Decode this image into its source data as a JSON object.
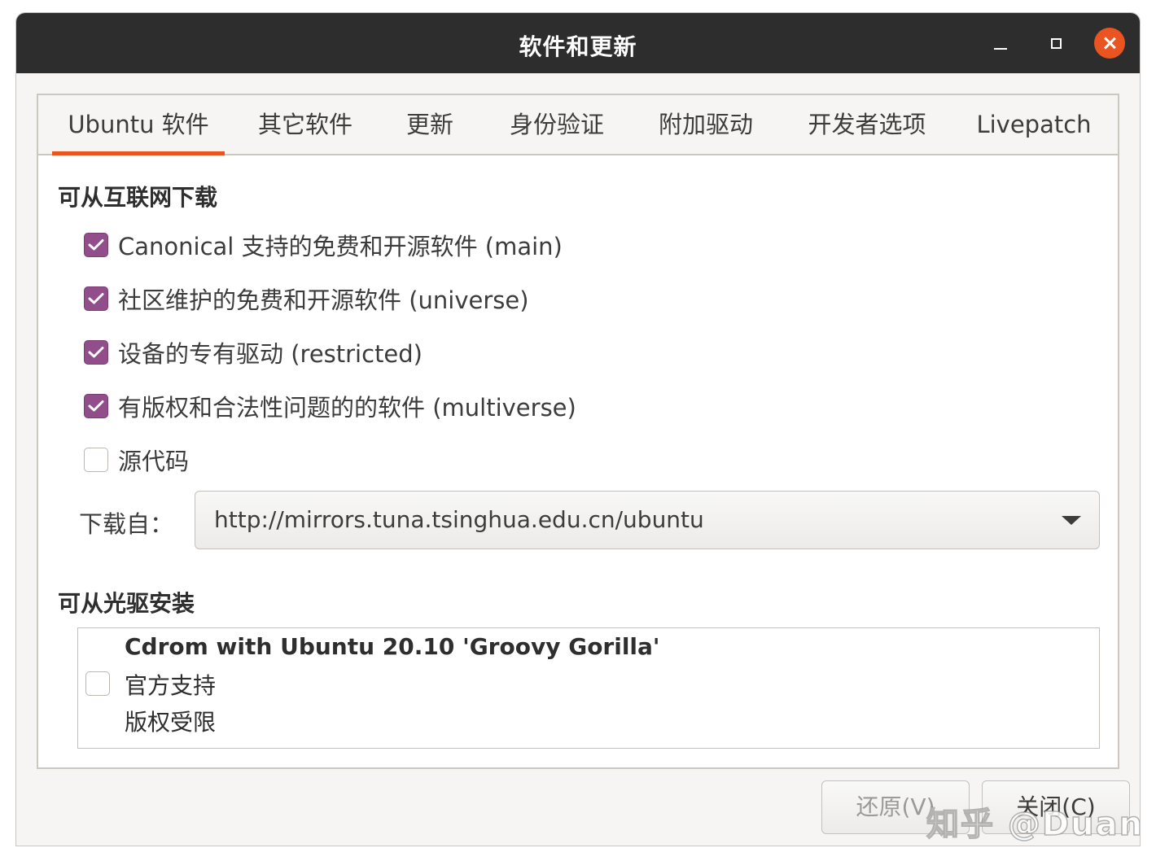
{
  "window": {
    "title": "软件和更新"
  },
  "tabs": [
    {
      "label": "Ubuntu 软件",
      "active": true
    },
    {
      "label": "其它软件",
      "active": false
    },
    {
      "label": "更新",
      "active": false
    },
    {
      "label": "身份验证",
      "active": false
    },
    {
      "label": "附加驱动",
      "active": false
    },
    {
      "label": "开发者选项",
      "active": false
    },
    {
      "label": "Livepatch",
      "active": false
    }
  ],
  "internet": {
    "title": "可从互联网下载",
    "options": [
      {
        "label": "Canonical 支持的免费和开源软件 (main)",
        "checked": true
      },
      {
        "label": "社区维护的免费和开源软件 (universe)",
        "checked": true
      },
      {
        "label": "设备的专有驱动 (restricted)",
        "checked": true
      },
      {
        "label": "有版权和合法性问题的的软件 (multiverse)",
        "checked": true
      },
      {
        "label": "源代码",
        "checked": false
      }
    ],
    "download_from_label": "下载自：",
    "download_from_value": "http://mirrors.tuna.tsinghua.edu.cn/ubuntu"
  },
  "cdrom": {
    "title": "可从光驱安装",
    "name": "Cdrom with Ubuntu 20.10 'Groovy Gorilla'",
    "line2": "官方支持",
    "line3": "版权受限",
    "checked": false
  },
  "buttons": {
    "revert": "还原(V)",
    "close": "关闭(C)"
  },
  "watermark": "知乎 @Duang",
  "colors": {
    "accent": "#e95420",
    "checkbox": "#924d8b",
    "titlebar": "#2d2d2d"
  }
}
